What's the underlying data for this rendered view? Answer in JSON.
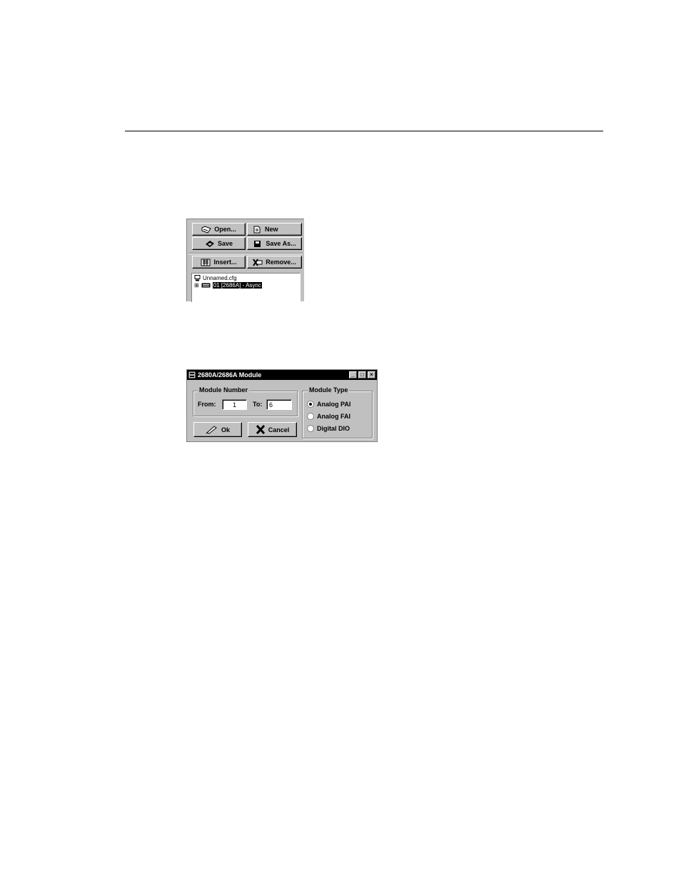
{
  "toolbar": {
    "open_label": "Open...",
    "new_label": "New",
    "save_label": "Save",
    "save_as_label": "Save As...",
    "insert_label": "Insert...",
    "remove_label": "Remove..."
  },
  "tree": {
    "root_label": "Unnamed.cfg",
    "expand_glyph": "⊞",
    "child_label": "01 [2686A] - Async"
  },
  "dialog": {
    "title": "2680A/2686A Module",
    "minimize_glyph": "_",
    "maximize_glyph": "□",
    "close_glyph": "×",
    "module_number": {
      "label": "Module Number",
      "from_label": "From:",
      "from_value": "1",
      "to_label": "To:",
      "to_value": "6"
    },
    "module_type": {
      "label": "Module Type",
      "options": [
        "Analog PAI",
        "Analog FAI",
        "Digital DIO"
      ],
      "selected": "Analog PAI"
    },
    "ok_label": "Ok",
    "cancel_label": "Cancel"
  }
}
